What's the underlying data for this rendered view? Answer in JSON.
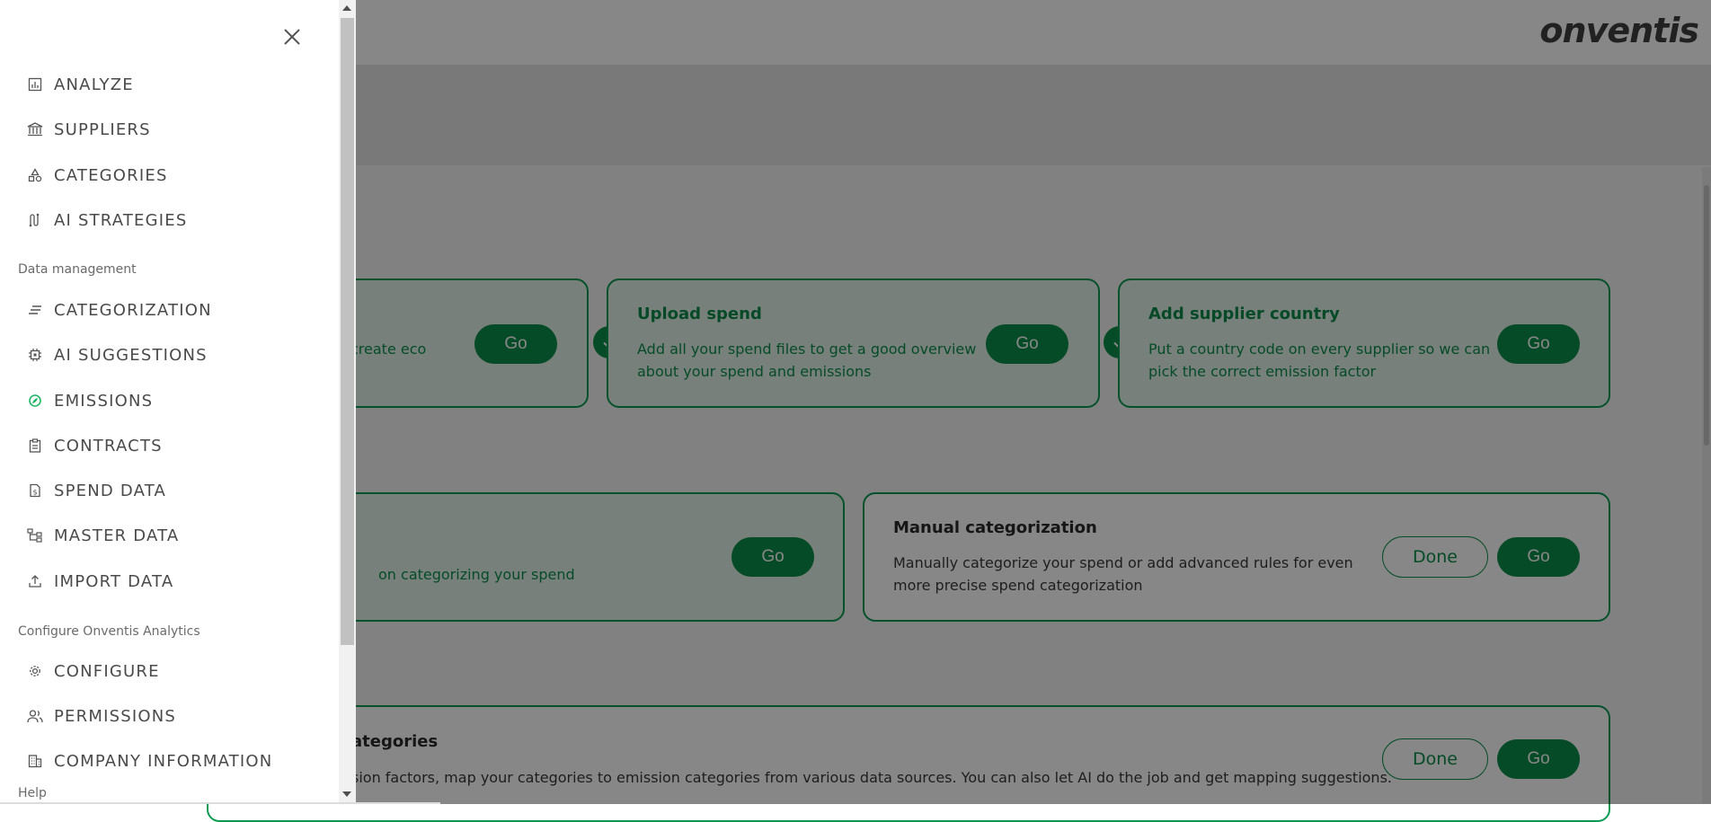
{
  "brand": {
    "logo": "onventis"
  },
  "nav": {
    "main_items": [
      {
        "label": "ANALYZE",
        "icon": "bar-chart-icon"
      },
      {
        "label": "SUPPLIERS",
        "icon": "bank-icon"
      },
      {
        "label": "CATEGORIES",
        "icon": "shapes-icon"
      },
      {
        "label": "AI STRATEGIES",
        "icon": "route-icon"
      }
    ],
    "sections": {
      "data_management": "Data management",
      "configure": "Configure Onventis Analytics",
      "help": "Help"
    },
    "data_items": [
      {
        "label": "CATEGORIZATION",
        "icon": "lines-icon"
      },
      {
        "label": "AI SUGGESTIONS",
        "icon": "chip-icon"
      },
      {
        "label": "EMISSIONS",
        "icon": "leaf-icon"
      },
      {
        "label": "CONTRACTS",
        "icon": "clipboard-icon"
      },
      {
        "label": "SPEND DATA",
        "icon": "dollar-file-icon"
      },
      {
        "label": "MASTER DATA",
        "icon": "hierarchy-icon"
      },
      {
        "label": "IMPORT DATA",
        "icon": "upload-icon"
      }
    ],
    "config_items": [
      {
        "label": "CONFIGURE",
        "icon": "gear-icon"
      },
      {
        "label": "PERMISSIONS",
        "icon": "users-icon"
      },
      {
        "label": "COMPANY INFORMATION",
        "icon": "building-icon"
      }
    ]
  },
  "cards": {
    "card1": {
      "desc": "create eco",
      "go": "Go"
    },
    "upload": {
      "title": "Upload spend",
      "desc1": "Add all your spend files to get a good overview",
      "desc2": "about your spend and emissions",
      "go": "Go"
    },
    "country": {
      "title": "Add supplier country",
      "desc1": "Put a country code on every supplier so we can",
      "desc2": "pick the correct emission factor",
      "go": "Go"
    },
    "auto": {
      "desc": "on categorizing your spend",
      "go": "Go"
    },
    "manual": {
      "title": "Manual categorization",
      "desc1": "Manually categorize your spend or add advanced rules for even",
      "desc2": "more precise spend categorization",
      "done": "Done",
      "go": "Go"
    },
    "emission": {
      "title": "ategories",
      "desc": "sion factors, map your categories to emission categories from various data sources. You can also let AI do the job and get mapping suggestions.",
      "done": "Done",
      "go": "Go"
    }
  },
  "colors": {
    "accent": "#0a8f4b",
    "card_fill": "#e3f1e9",
    "overlay": "#000000"
  }
}
